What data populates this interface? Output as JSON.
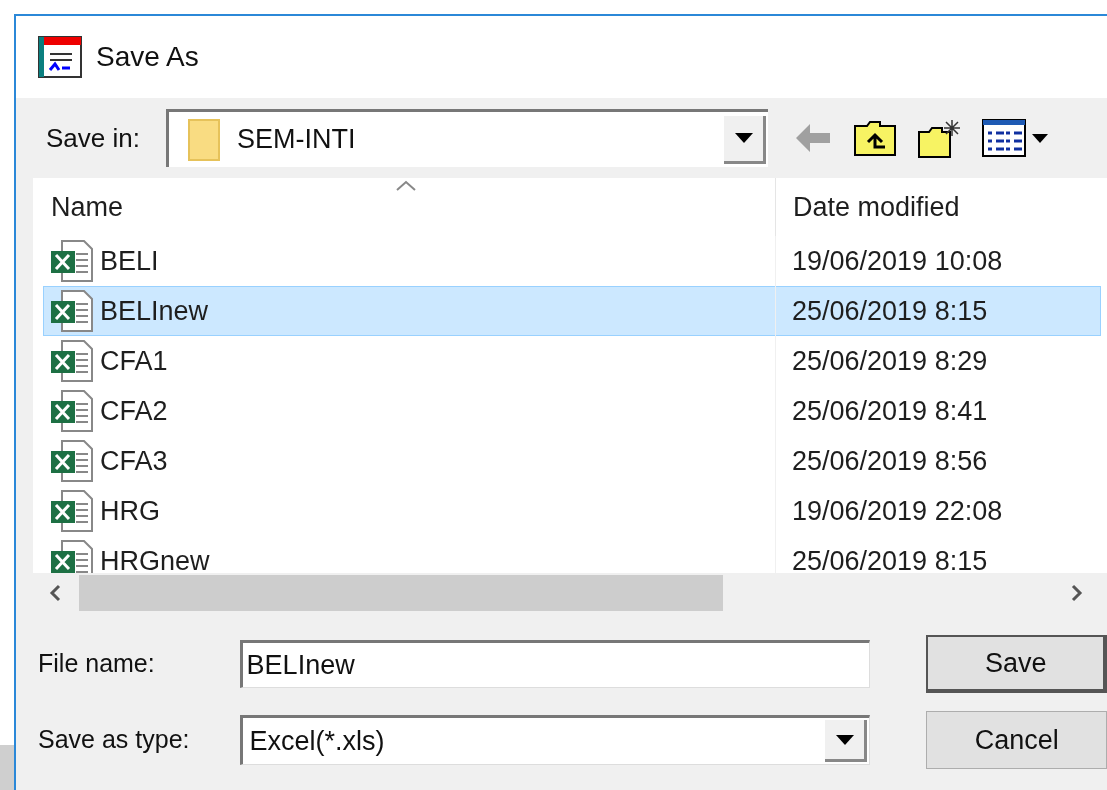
{
  "window": {
    "title": "Save As"
  },
  "save_in": {
    "label": "Save in:",
    "value": "SEM-INTI"
  },
  "columns": [
    {
      "label": "Name",
      "sorted": true
    },
    {
      "label": "Date modified",
      "sorted": false
    }
  ],
  "files": [
    {
      "name": "BELI",
      "date": "19/06/2019 10:08",
      "selected": false
    },
    {
      "name": "BELInew",
      "date": "25/06/2019 8:15",
      "selected": true
    },
    {
      "name": "CFA1",
      "date": "25/06/2019 8:29",
      "selected": false
    },
    {
      "name": "CFA2",
      "date": "25/06/2019 8:41",
      "selected": false
    },
    {
      "name": "CFA3",
      "date": "25/06/2019 8:56",
      "selected": false
    },
    {
      "name": "HRG",
      "date": "19/06/2019 22:08",
      "selected": false
    },
    {
      "name": "HRGnew",
      "date": "25/06/2019 8:15",
      "selected": false
    }
  ],
  "file_name": {
    "label": "File name:",
    "value": "BELInew"
  },
  "save_as_type": {
    "label": "Save as type:",
    "value": "Excel(*.xls)"
  },
  "buttons": [
    "Save",
    "Cancel"
  ]
}
